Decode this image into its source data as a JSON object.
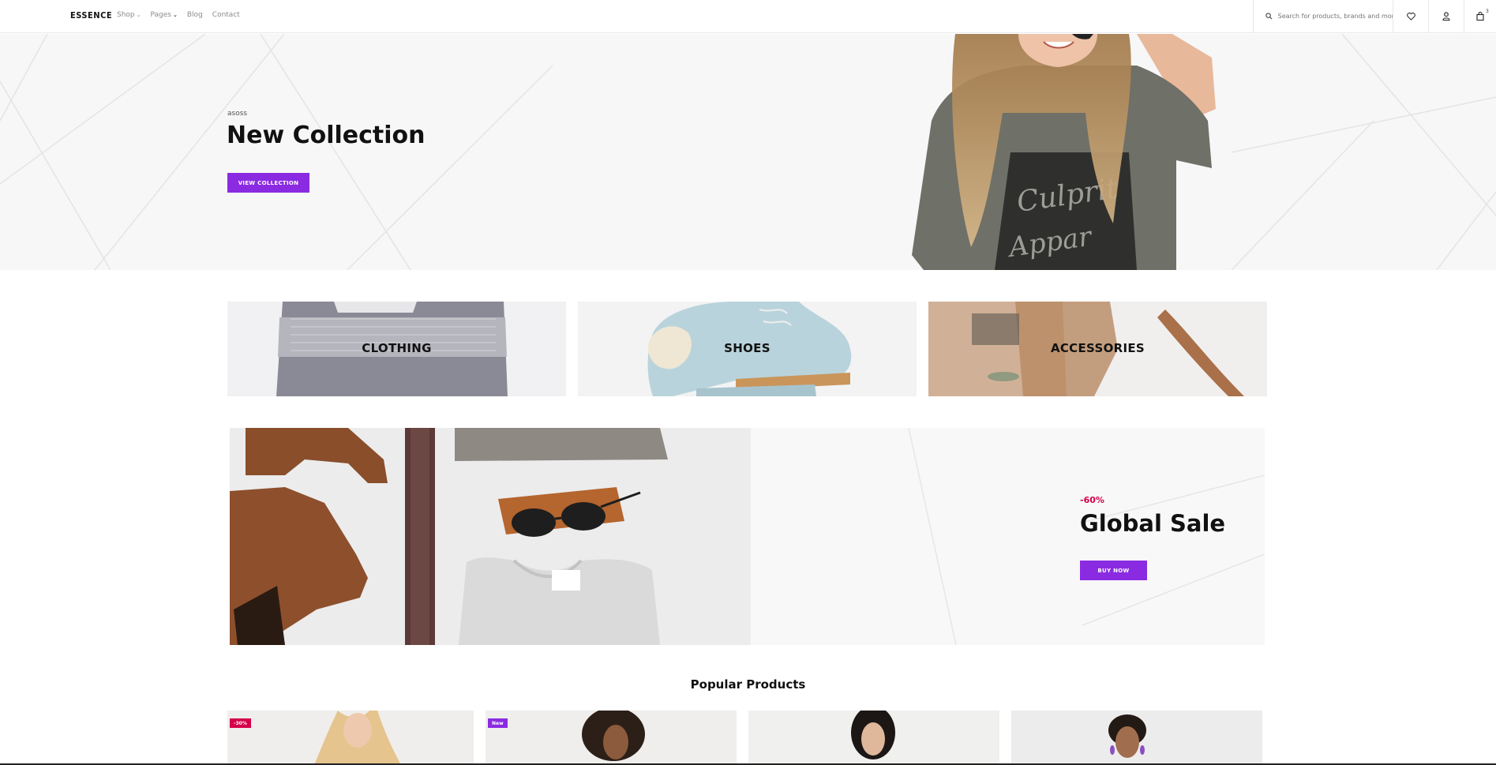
{
  "header": {
    "logo": "ESSENCE",
    "nav": [
      {
        "label": "Shop",
        "has_dropdown": true
      },
      {
        "label": "Pages",
        "has_dropdown": true
      },
      {
        "label": "Blog",
        "has_dropdown": false
      },
      {
        "label": "Contact",
        "has_dropdown": false
      }
    ],
    "search_placeholder": "Search for products, brands and more.",
    "cart_count": "3",
    "icons": [
      "search-icon",
      "heart-icon",
      "user-icon",
      "cart-icon"
    ]
  },
  "hero": {
    "subtitle": "asoss",
    "title": "New Collection",
    "button": "VIEW COLLECTION"
  },
  "categories": [
    {
      "label": "CLOTHING"
    },
    {
      "label": "SHOES"
    },
    {
      "label": "ACCESSORIES"
    }
  ],
  "sale": {
    "discount": "-60%",
    "title": "Global Sale",
    "button": "BUY NOW"
  },
  "popular": {
    "title": "Popular Products",
    "products": [
      {
        "badge": "-30%",
        "badge_color": "#d6004a"
      },
      {
        "badge": "New",
        "badge_color": "#8a2be2"
      },
      {
        "badge": "",
        "badge_color": ""
      },
      {
        "badge": "",
        "badge_color": ""
      }
    ]
  },
  "colors": {
    "accent": "#8a2be2",
    "sale_red": "#d6004a"
  }
}
